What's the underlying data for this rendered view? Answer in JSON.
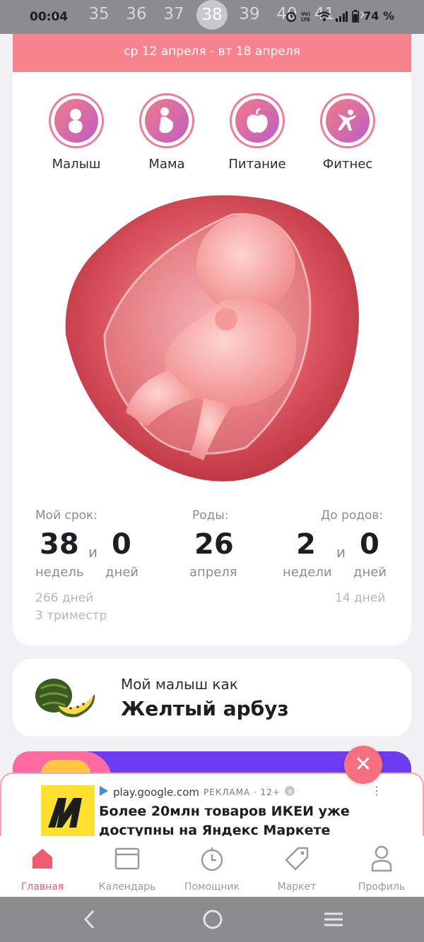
{
  "status_bar": {
    "time": "00:04",
    "battery": "74 %",
    "icons": [
      "alarm-icon",
      "volte-icon",
      "wifi-icon",
      "signal-icon",
      "battery-icon"
    ]
  },
  "week_selector": {
    "weeks": [
      "35",
      "36",
      "37",
      "38",
      "39",
      "40",
      "41"
    ],
    "selected": "38"
  },
  "date_range": "ср 12 апреля - вт 18 апреля",
  "categories": [
    {
      "label": "Малыш",
      "icon": "baby-icon"
    },
    {
      "label": "Мама",
      "icon": "pregnant-mother-icon"
    },
    {
      "label": "Питание",
      "icon": "apple-icon"
    },
    {
      "label": "Фитнес",
      "icon": "yoga-icon"
    }
  ],
  "term": {
    "my_term_label": "Мой срок:",
    "weeks": "38",
    "and1": "и",
    "days": "0",
    "weeks_unit": "недель",
    "days_unit": "дней",
    "total_days": "266 дней",
    "trimester": "3 триместр",
    "birth_label": "Роды:",
    "birth_day": "26",
    "birth_month": "апреля",
    "until_label": "До родов:",
    "until_weeks": "2",
    "and2": "и",
    "until_days": "0",
    "until_weeks_unit": "недели",
    "until_days_unit": "дней",
    "until_total": "14 дней"
  },
  "baby_size": {
    "subtitle": "Мой малыш как",
    "title": "Желтый арбуз"
  },
  "ad": {
    "source": "play.google.com",
    "tag": "РЕКЛАМА · 12+",
    "title": "Более 20млн товаров ИКЕИ уже доступны на Яндекс Маркете"
  },
  "bottom_nav": [
    {
      "label": "Главная",
      "icon": "home-icon",
      "active": true
    },
    {
      "label": "Календарь",
      "icon": "calendar-icon",
      "active": false
    },
    {
      "label": "Помощник",
      "icon": "stopwatch-icon",
      "active": false
    },
    {
      "label": "Маркет",
      "icon": "tag-icon",
      "active": false
    },
    {
      "label": "Профиль",
      "icon": "profile-icon",
      "active": false
    }
  ],
  "colors": {
    "accent": "#f05a73",
    "date_band": "#f7838f",
    "promo": "#6d3cf0"
  }
}
